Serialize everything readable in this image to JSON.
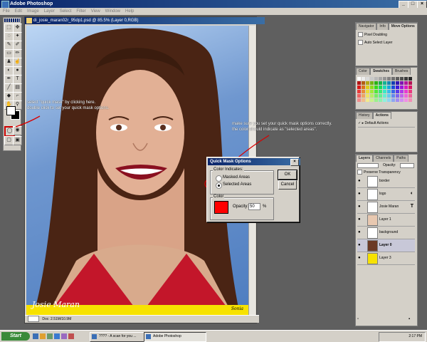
{
  "app": {
    "title": "Adobe Photoshop",
    "window_buttons": [
      "_",
      "□",
      "×"
    ]
  },
  "menu": [
    "File",
    "Edit",
    "Image",
    "Layer",
    "Select",
    "Filter",
    "View",
    "Window",
    "Help"
  ],
  "document": {
    "title": "di_josie_maran02r_95dp1.psd @ 85.5% (Layer 0,RGB)",
    "status": "Doc: 2.51M/10.9M",
    "signature": "Josie Maran",
    "signature_small": "Sonia"
  },
  "annotations": {
    "left_line1": "select \"quick mask\" by clicking here.",
    "left_line2": "double click to set your quick mask options.",
    "right_line1": "make sure you set your quick mask options correctly.",
    "right_line2": "the color should indicate as \"selected areas\"."
  },
  "dialog": {
    "title": "Quick Mask Options",
    "close": "×",
    "color_indicates_label": "Color Indicates:",
    "option_masked": "Masked Areas",
    "option_selected": "Selected Areas",
    "selected_option": "Selected Areas",
    "color_label": "Color",
    "opacity_label": "Opacity:",
    "opacity_value": "50",
    "opacity_unit": "%",
    "ok_label": "OK",
    "cancel_label": "Cancel",
    "mask_color": "#ff0000"
  },
  "panels": {
    "navigator_tabs": [
      "Navigator",
      "Info",
      "Move Options"
    ],
    "navigator_active": "Move Options",
    "pixel_doubling": "Pixel Doubling",
    "auto_select": "Auto Select Layer",
    "color_tabs": [
      "Color",
      "Swatches",
      "Brushes"
    ],
    "color_active": "Swatches",
    "history_tabs": [
      "History",
      "Actions"
    ],
    "history_active": "Actions",
    "default_actions": "Default Actions",
    "layers_tabs": [
      "Layers",
      "Channels",
      "Paths"
    ],
    "layers_active": "Layers",
    "opacity_label": "Opacity:",
    "preserve_transparency": "Preserve Transparency",
    "layers": [
      {
        "name": "border",
        "selected": false,
        "thumb_color": "#ffffff"
      },
      {
        "name": "logo",
        "selected": false,
        "thumb_color": "#ffffff"
      },
      {
        "name": "Josie Maran",
        "selected": false,
        "thumb_color": "#ffffff"
      },
      {
        "name": "Layer 1",
        "selected": false,
        "thumb_color": "#e8c8b0"
      },
      {
        "name": "background",
        "selected": false,
        "thumb_color": "#ffffff"
      },
      {
        "name": "Layer 0",
        "selected": true,
        "thumb_color": "#6b3a24"
      },
      {
        "name": "Layer 3",
        "selected": false,
        "thumb_color": "#f7e200"
      }
    ]
  },
  "taskbar": {
    "start_label": "Start",
    "tasks": [
      "???? - A scan for you ...",
      "Adobe Photoshop"
    ],
    "active_task": "Adobe Photoshop",
    "clock": "2:17 PM"
  }
}
